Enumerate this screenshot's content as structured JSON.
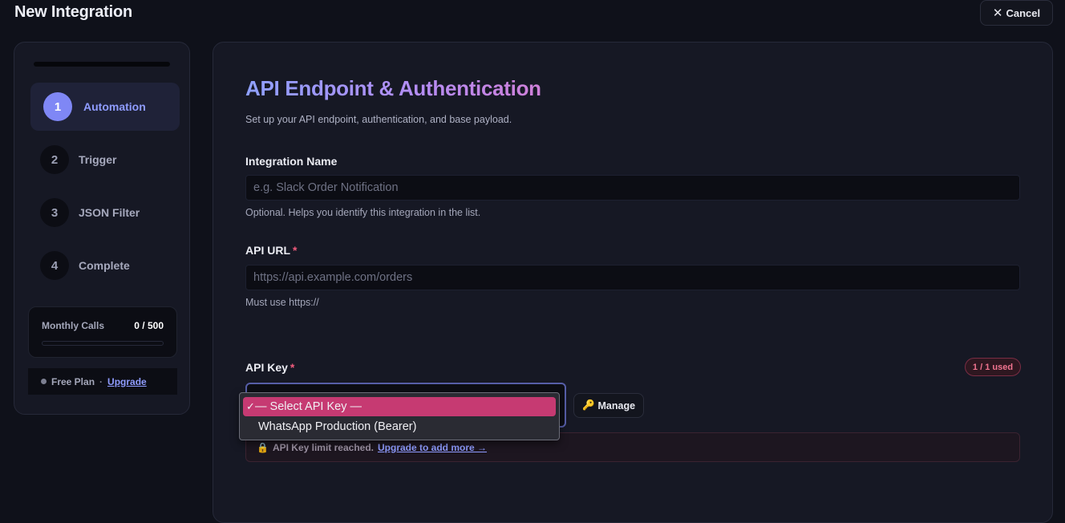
{
  "header": {
    "title": "New Integration",
    "cancel_label": "Cancel"
  },
  "sidebar": {
    "steps": [
      {
        "number": "1",
        "label": "Automation",
        "active": true
      },
      {
        "number": "2",
        "label": "Trigger"
      },
      {
        "number": "3",
        "label": "JSON Filter"
      },
      {
        "number": "4",
        "label": "Complete"
      }
    ],
    "usage": {
      "label": "Monthly Calls",
      "count": "0 / 500",
      "fraction": 0
    },
    "plan": {
      "name": "Free Plan",
      "separator": "·",
      "upgrade_label": "Upgrade"
    }
  },
  "main": {
    "title": "API Endpoint & Authentication",
    "subtitle": "Set up your API endpoint, authentication, and base payload.",
    "integration_name": {
      "label": "Integration Name",
      "value": "",
      "placeholder": "e.g. Slack Order Notification",
      "hint": "Optional. Helps you identify this integration in the list."
    },
    "api_url": {
      "label": "API URL",
      "required_mark": "*",
      "value": "",
      "placeholder": "https://api.example.com/orders",
      "hint": "Must use https://"
    },
    "api_key": {
      "label": "API Key",
      "required_mark": "*",
      "usage_badge": "1 / 1 used",
      "manage_label": "Manage",
      "limit_icon": "🔒",
      "limit_text": "API Key limit reached.",
      "limit_link": "Upgrade to add more →",
      "options": [
        {
          "check": "✓",
          "label": "— Select API Key —",
          "selected": true
        },
        {
          "label": "WhatsApp Production (Bearer)"
        }
      ]
    }
  },
  "colors": {
    "background": "#0f111a",
    "panel": "#161824",
    "accent": "#7f87f5",
    "selected_option": "#c63a72",
    "danger": "#f05b7c"
  },
  "icons": {
    "cancel": "close-icon",
    "manage": "key-icon",
    "limit": "lock-icon",
    "selected": "check-icon"
  }
}
